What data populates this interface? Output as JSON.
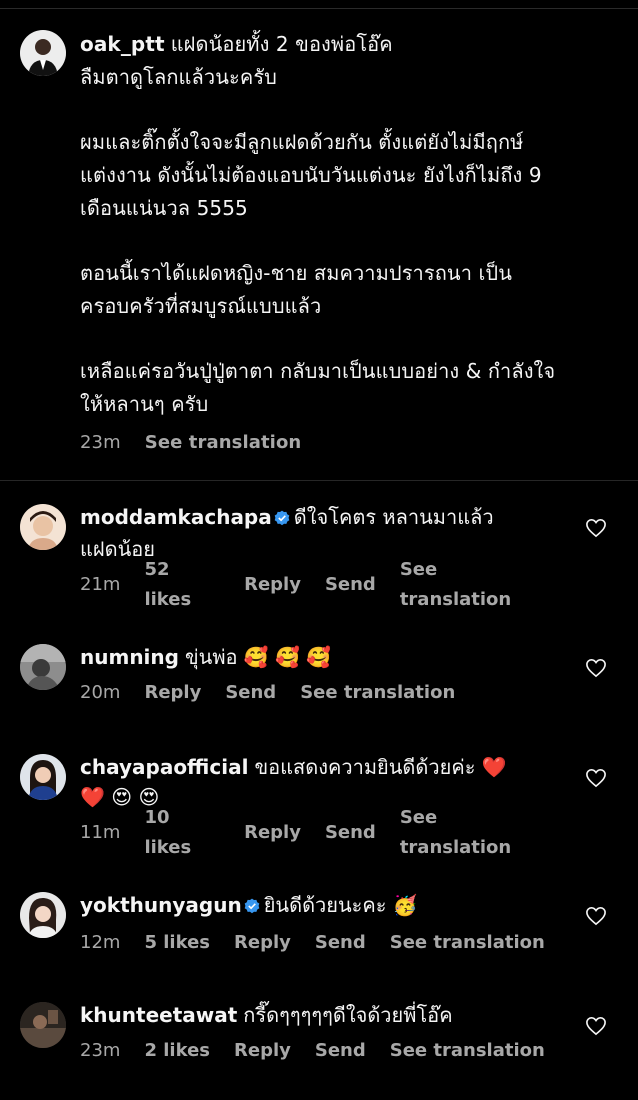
{
  "post": {
    "username": "oak_ptt",
    "lines": [
      "แฝดน้อยทั้ง 2 ของพ่อโอ๊ค",
      "ลืมตาดูโลกแล้วนะครับ"
    ],
    "paragraph2": [
      "ผมและติ๊กตั้งใจจะมีลูกแฝดด้วยกัน ตั้งแต่ยังไม่มีฤกษ์",
      "แต่งงาน ดังนั้นไม่ต้องแอบนับวันแต่งนะ ยังไงก็ไม่ถึง 9",
      "เดือนแน่นวล 5555"
    ],
    "paragraph3": [
      "ตอนนี้เราได้แฝดหญิง-ชาย สมความปรารถนา เป็น",
      "ครอบครัวที่สมบูรณ์แบบแล้ว"
    ],
    "paragraph4": [
      "เหลือแค่รอวันปู่ปู่ตาตา กลับมาเป็นแบบอย่าง & กำลังใจ",
      "ให้หลานๆ ครับ"
    ],
    "time": "23m",
    "see_translation": "See translation"
  },
  "comments": [
    {
      "username": "moddamkachapa",
      "verified": true,
      "line1": "ดีใจโคตร หลานมาแล้ว",
      "line2": "แฝดน้อย",
      "time": "21m",
      "likes": "52 likes",
      "reply": "Reply",
      "send": "Send",
      "see_translation": "See translation"
    },
    {
      "username": "numning",
      "verified": false,
      "line1": "ขุ่นพ่อ 🥰 🥰 🥰",
      "time": "20m",
      "reply": "Reply",
      "send": "Send",
      "see_translation": "See translation"
    },
    {
      "username": "chayapaofficial",
      "verified": false,
      "line1": "ขอแสดงความยินดีด้วยค่ะ ❤️",
      "line2": "❤️ 😍 😍",
      "time": "11m",
      "likes": "10 likes",
      "reply": "Reply",
      "send": "Send",
      "see_translation": "See translation"
    },
    {
      "username": "yokthunyagun",
      "verified": true,
      "line1": "ยินดีด้วยนะคะ 🥳",
      "time": "12m",
      "likes": "5 likes",
      "reply": "Reply",
      "send": "Send",
      "see_translation": "See translation"
    },
    {
      "username": "khunteetawat",
      "verified": false,
      "line1": "กรี๊ดๆๆๆๆๆดีใจด้วยพี่โอ๊ค",
      "time": "23m",
      "likes": "2 likes",
      "reply": "Reply",
      "send": "Send",
      "see_translation": "See translation"
    }
  ],
  "colors": {
    "background": "#000000",
    "text": "#f5f5f5",
    "secondary": "#a8a8a8",
    "verified": "#3897f0"
  }
}
